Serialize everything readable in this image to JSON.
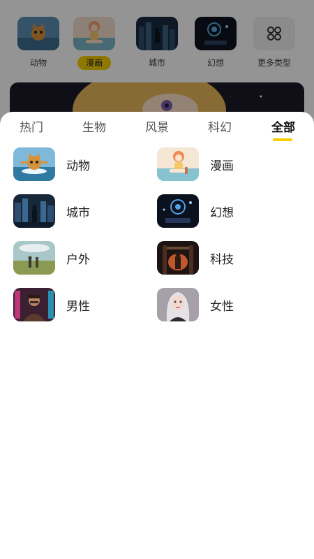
{
  "background": {
    "categories": [
      {
        "label": "动物",
        "active": false
      },
      {
        "label": "漫画",
        "active": true
      },
      {
        "label": "城市",
        "active": false
      },
      {
        "label": "幻想",
        "active": false
      }
    ],
    "more_label": "更多类型",
    "more_icon": "grid-icon"
  },
  "sheet": {
    "tabs": [
      {
        "label": "热门",
        "active": false
      },
      {
        "label": "生物",
        "active": false
      },
      {
        "label": "风景",
        "active": false
      },
      {
        "label": "科幻",
        "active": false
      },
      {
        "label": "全部",
        "active": true
      }
    ],
    "accent_color": "#f6cf00",
    "items": [
      {
        "label": "动物"
      },
      {
        "label": "漫画"
      },
      {
        "label": "城市"
      },
      {
        "label": "幻想"
      },
      {
        "label": "户外"
      },
      {
        "label": "科技"
      },
      {
        "label": "男性"
      },
      {
        "label": "女性"
      }
    ]
  }
}
